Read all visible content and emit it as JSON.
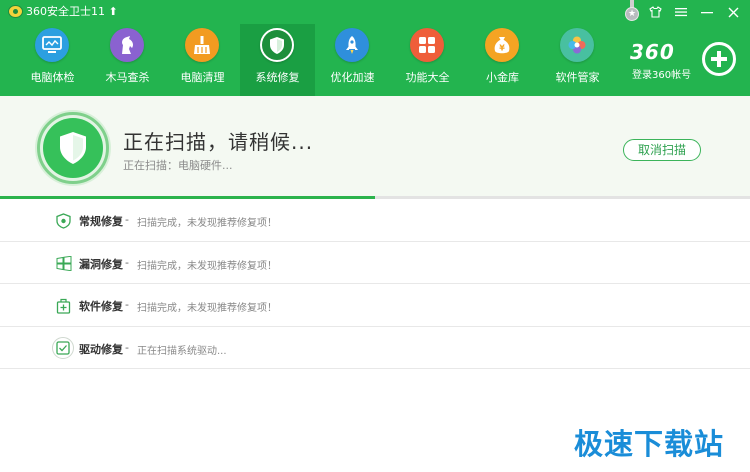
{
  "app": {
    "title": "360安全卫士11"
  },
  "window_controls": [
    {
      "name": "skin-icon",
      "glyph": "👕"
    },
    {
      "name": "menu-icon",
      "glyph": "☰"
    },
    {
      "name": "minimize-icon",
      "glyph": "—"
    },
    {
      "name": "close-icon",
      "glyph": "✕"
    }
  ],
  "nav": {
    "items": [
      {
        "label": "电脑体检",
        "icon": "monitor-icon",
        "color": "#2c9fe0"
      },
      {
        "label": "木马查杀",
        "icon": "horse-icon",
        "color": "#8a62d0"
      },
      {
        "label": "电脑清理",
        "icon": "broom-icon",
        "color": "#f29b21"
      },
      {
        "label": "系统修复",
        "icon": "shield-icon",
        "color": "#1d8f3b"
      },
      {
        "label": "优化加速",
        "icon": "rocket-icon",
        "color": "#2f8fdc"
      },
      {
        "label": "功能大全",
        "icon": "grid-icon",
        "color": "#ef5e3a"
      },
      {
        "label": "小金库",
        "icon": "money-bag-icon",
        "color": "#f4a423"
      },
      {
        "label": "软件管家",
        "icon": "app-store-icon",
        "color": "#48c0a0"
      }
    ],
    "active_index": 3
  },
  "account": {
    "logo": "360",
    "login_label": "登录360帐号"
  },
  "scan": {
    "title": "正在扫描，请稍候...",
    "status": "正在扫描：电脑硬件...",
    "cancel_label": "取消扫描",
    "progress_fraction": 0.5
  },
  "repairs": [
    {
      "label": "常规修复",
      "dash": "-",
      "status": "扫描完成，未发现推荐修复项！",
      "icon": "shield-check-icon"
    },
    {
      "label": "漏洞修复",
      "dash": "-",
      "status": "扫描完成，未发现推荐修复项！",
      "icon": "windows-icon"
    },
    {
      "label": "软件修复",
      "dash": "-",
      "status": "扫描完成，未发现推荐修复项！",
      "icon": "package-icon"
    },
    {
      "label": "驱动修复",
      "dash": "-",
      "status": "正在扫描系统驱动...",
      "icon": "driver-icon"
    }
  ],
  "watermark": "极速下载站",
  "colors": {
    "header_green": "#23b44f",
    "active_tab_green": "#1a9f43",
    "progress_green": "#2bb34c",
    "watermark_blue": "#1a8dd8"
  }
}
